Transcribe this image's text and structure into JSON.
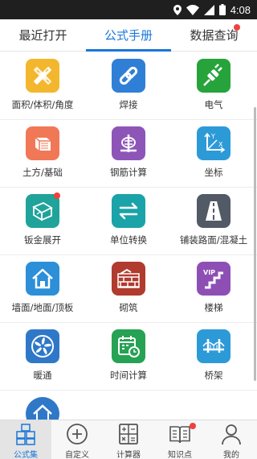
{
  "status_bar": {
    "time": "4:08",
    "icons": [
      "location-icon",
      "wifi-icon",
      "signal-icon",
      "battery-icon"
    ]
  },
  "top_tabs": [
    {
      "label": "最近打开",
      "active": false,
      "badge": false
    },
    {
      "label": "公式手册",
      "active": true,
      "badge": false
    },
    {
      "label": "数据查询",
      "active": false,
      "badge": true
    }
  ],
  "accent_color": "#1a77d9",
  "badge_color": "#f0413c",
  "grid": [
    {
      "label": "面积/体积/角度",
      "icon": "ruler-pencil-icon",
      "color": "#f3b72e",
      "badge": false
    },
    {
      "label": "焊接",
      "icon": "chain-link-icon",
      "color": "#2f7fd6",
      "badge": false
    },
    {
      "label": "电气",
      "icon": "plug-icon",
      "color": "#27a33c",
      "badge": false
    },
    {
      "label": "土方/基础",
      "icon": "earth-block-icon",
      "color": "#f07856",
      "badge": false
    },
    {
      "label": "钢筋计算",
      "icon": "rebar-icon",
      "color": "#8e55b8",
      "badge": false
    },
    {
      "label": "坐标",
      "icon": "axes-icon",
      "color": "#2d9ad8",
      "badge": false
    },
    {
      "label": "钣金展开",
      "icon": "sheet-metal-icon",
      "color": "#1fa39a",
      "badge": true
    },
    {
      "label": "单位转换",
      "icon": "swap-arrows-icon",
      "color": "#1aa3a8",
      "badge": false
    },
    {
      "label": "铺装路面/混凝土",
      "icon": "road-icon",
      "color": "#525a66",
      "badge": false
    },
    {
      "label": "墙面/地面/顶板",
      "icon": "house-icon",
      "color": "#2c8fd8",
      "badge": false
    },
    {
      "label": "砌筑",
      "icon": "brick-wall-icon",
      "color": "#b03b2e",
      "badge": false
    },
    {
      "label": "楼梯",
      "icon": "stairs-icon",
      "color": "#8e4fb5",
      "badge": false
    },
    {
      "label": "暖通",
      "icon": "fan-icon",
      "color": "#2f78c8",
      "badge": false
    },
    {
      "label": "时间计算",
      "icon": "calendar-clock-icon",
      "color": "#25a253",
      "badge": false
    },
    {
      "label": "桥架",
      "icon": "bridge-icon",
      "color": "#2d9ad8",
      "badge": false
    },
    {
      "label": "",
      "icon": "house-icon",
      "color": "#2f78c8",
      "badge": false
    }
  ],
  "vip_text": "VIP",
  "axis_text": {
    "x": "X",
    "y": "Y"
  },
  "bottom_nav": [
    {
      "label": "公式集",
      "icon": "formula-blocks-icon",
      "active": true,
      "badge": false
    },
    {
      "label": "自定义",
      "icon": "plus-circle-icon",
      "active": false,
      "badge": false
    },
    {
      "label": "计算器",
      "icon": "calculator-icon",
      "active": false,
      "badge": false
    },
    {
      "label": "知识点",
      "icon": "open-book-icon",
      "active": false,
      "badge": true
    },
    {
      "label": "我的",
      "icon": "person-icon",
      "active": false,
      "badge": false
    }
  ]
}
